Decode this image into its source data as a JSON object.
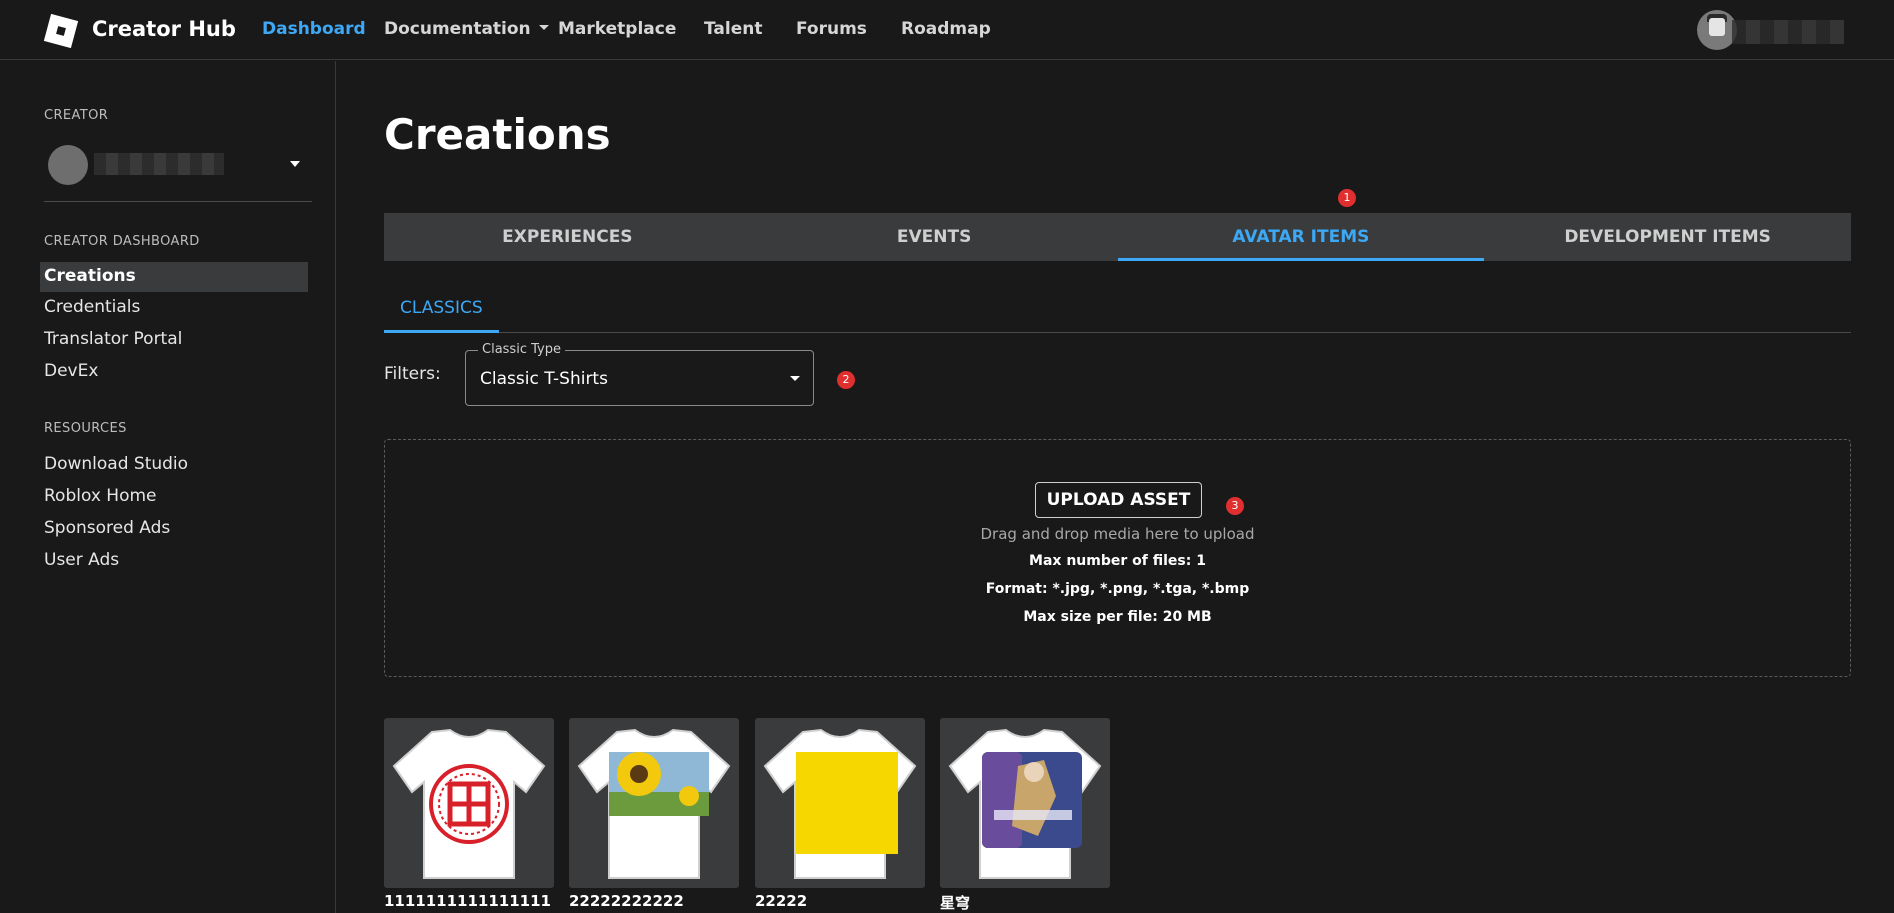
{
  "header": {
    "brand": "Creator Hub",
    "nav": [
      {
        "label": "Dashboard",
        "active": true
      },
      {
        "label": "Documentation",
        "has_dropdown": true
      },
      {
        "label": "Marketplace"
      },
      {
        "label": "Talent"
      },
      {
        "label": "Forums"
      },
      {
        "label": "Roadmap"
      }
    ],
    "icons": {
      "logo": "roblox-logo-icon",
      "dropdown": "caret-down-icon",
      "user": "user-avatar"
    }
  },
  "sidebar": {
    "creator_title": "CREATOR",
    "dashboard_title": "CREATOR DASHBOARD",
    "dashboard_items": [
      {
        "label": "Creations",
        "active": true
      },
      {
        "label": "Credentials"
      },
      {
        "label": "Translator Portal"
      },
      {
        "label": "DevEx"
      }
    ],
    "resources_title": "RESOURCES",
    "resources_items": [
      {
        "label": "Download Studio"
      },
      {
        "label": "Roblox Home"
      },
      {
        "label": "Sponsored Ads"
      },
      {
        "label": "User Ads"
      }
    ]
  },
  "main": {
    "title": "Creations",
    "tabs": [
      {
        "label": "EXPERIENCES"
      },
      {
        "label": "EVENTS"
      },
      {
        "label": "AVATAR ITEMS",
        "active": true
      },
      {
        "label": "DEVELOPMENT ITEMS"
      }
    ],
    "subtab": "CLASSICS",
    "filters_label": "Filters:",
    "select": {
      "legend": "Classic Type",
      "value": "Classic T-Shirts"
    },
    "upload": {
      "button": "UPLOAD ASSET",
      "hint": "Drag and drop media here to upload",
      "max_files": "Max number of files: 1",
      "format": "Format: *.jpg, *.png, *.tga, *.bmp",
      "max_size": "Max size per file: 20 MB"
    },
    "badges": [
      "1",
      "2",
      "3"
    ],
    "items": [
      {
        "name": "1111111111111111",
        "art": "fu-character-red"
      },
      {
        "name": "22222222222",
        "art": "sunflower"
      },
      {
        "name": "22222",
        "art": "yellow-square"
      },
      {
        "name": "星穹",
        "art": "anime-starrail"
      }
    ]
  },
  "colors": {
    "background": "#191919",
    "accent": "#3da8f5",
    "tab_bar": "#393b3d",
    "badge": "#e02f2f"
  }
}
